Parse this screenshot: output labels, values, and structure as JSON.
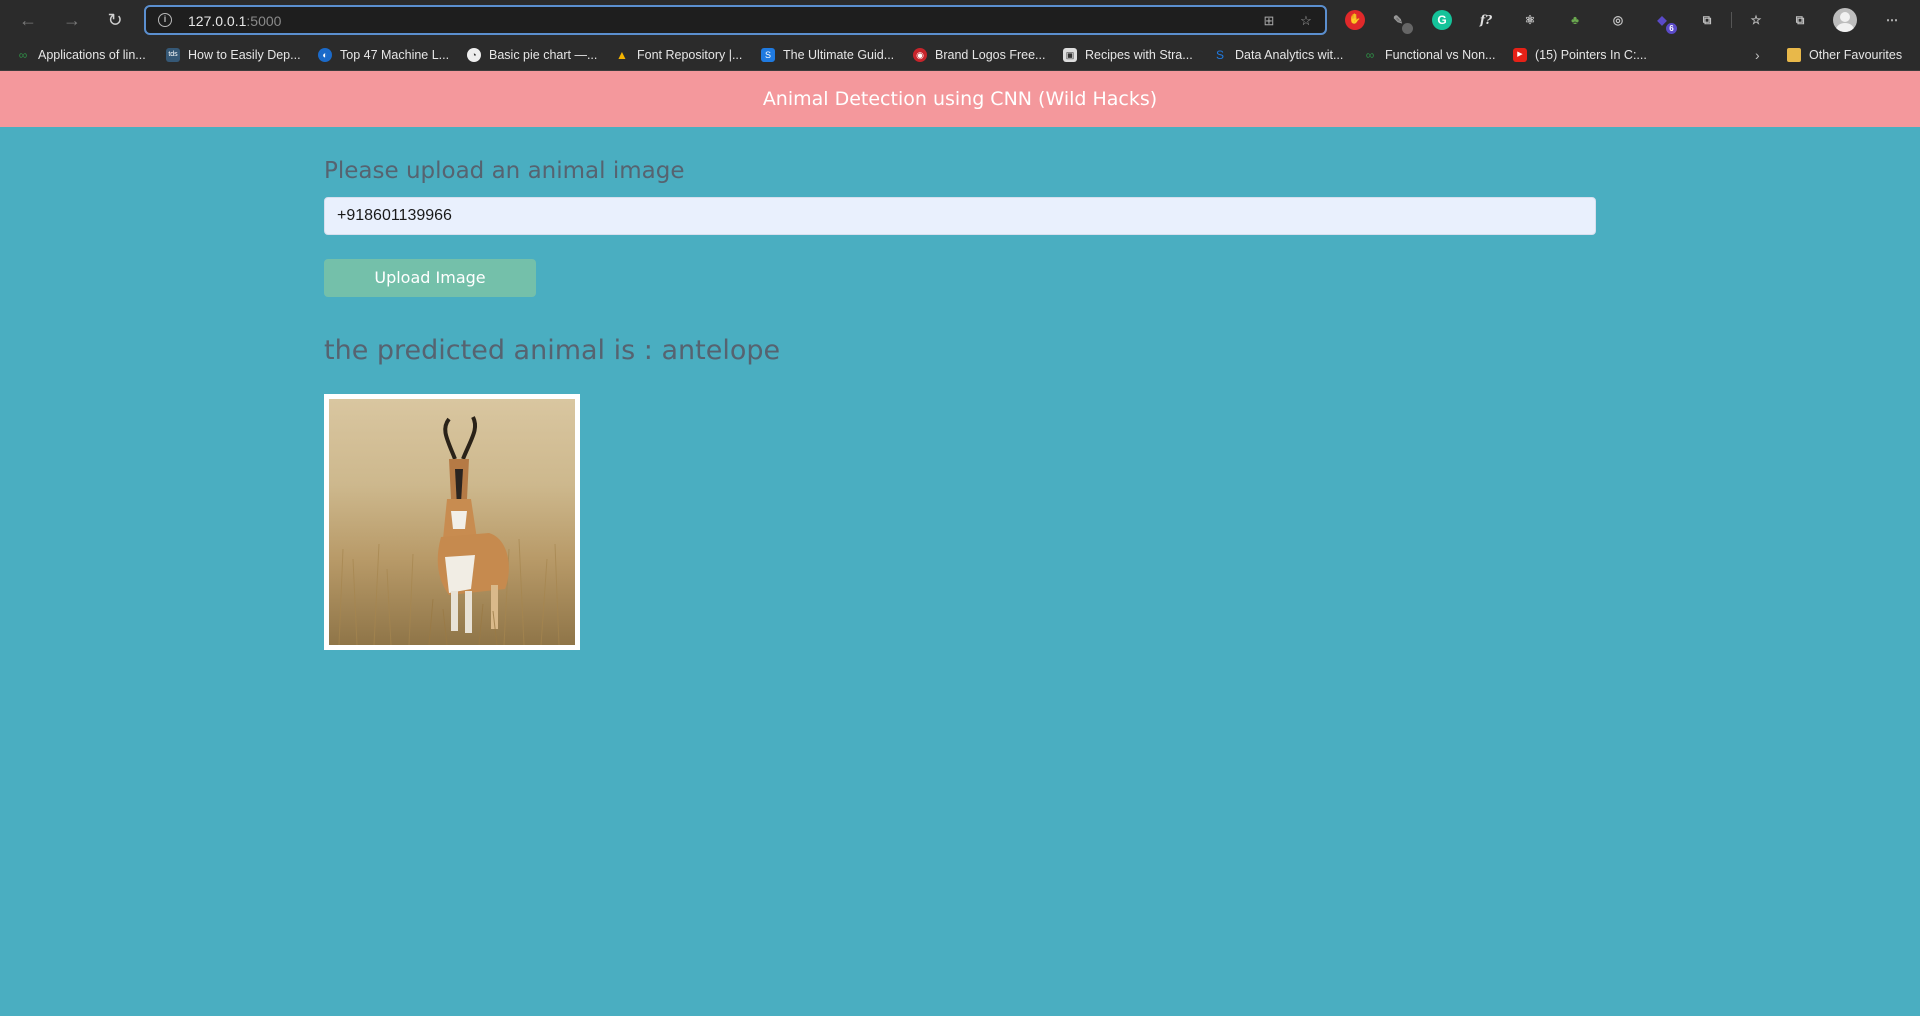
{
  "browser": {
    "url_host": "127.0.0.1",
    "url_port": ":5000",
    "extensions": [
      {
        "icon": "hand-stop-icon",
        "color": "#e0292a"
      },
      {
        "icon": "pen-tool-icon",
        "color": "#555"
      },
      {
        "icon": "grammarly-icon",
        "color": "#15c39a",
        "glyph": "G"
      },
      {
        "icon": "formula-icon",
        "color": "transparent",
        "glyph": "f?"
      },
      {
        "icon": "react-icon",
        "color": "transparent",
        "glyph": "⚛"
      },
      {
        "icon": "tree-icon",
        "color": "transparent",
        "glyph": "🌳"
      },
      {
        "icon": "target-icon",
        "color": "transparent",
        "glyph": "◎"
      },
      {
        "icon": "extension-badge-icon",
        "color": "transparent",
        "glyph": "",
        "badge": "6"
      }
    ]
  },
  "bookmarks": [
    {
      "label": "Applications of lin...",
      "icon": "geeks-icon",
      "color": "#2f8d46",
      "glyph": "∞"
    },
    {
      "label": "How to Easily Dep...",
      "icon": "tds-icon",
      "color": "#355876",
      "glyph": "tds"
    },
    {
      "label": "Top 47 Machine L...",
      "icon": "springboard-icon",
      "color": "#1b6ac9",
      "glyph": "◐"
    },
    {
      "label": "Basic pie chart —...",
      "icon": "matplotlib-icon",
      "color": "#eeeeee",
      "glyph": "◔"
    },
    {
      "label": "Font Repository |...",
      "icon": "drive-icon",
      "color": "transparent",
      "glyph": "▲"
    },
    {
      "label": "The Ultimate Guid...",
      "icon": "s-blue-icon",
      "color": "#1f7ae0",
      "glyph": "S"
    },
    {
      "label": "Brand Logos Free...",
      "icon": "brand-logos-icon",
      "color": "#c7242b",
      "glyph": "◉"
    },
    {
      "label": "Recipes with Stra...",
      "icon": "recipes-icon",
      "color": "#dddddd",
      "glyph": "▣"
    },
    {
      "label": "Data Analytics wit...",
      "icon": "data-analytics-icon",
      "color": "transparent",
      "glyph": "S"
    },
    {
      "label": "Functional vs Non...",
      "icon": "geeks-icon",
      "color": "#2f8d46",
      "glyph": "∞"
    },
    {
      "label": "(15) Pointers In C:...",
      "icon": "youtube-icon",
      "color": "#e62117",
      "glyph": "▶"
    }
  ],
  "other_favourites": "Other Favourites",
  "app": {
    "title": "Animal Detection using CNN (Wild Hacks)",
    "upload_label": "Please upload an animal image",
    "file_input_value": "+918601139966",
    "upload_button": "Upload Image",
    "prediction_text": "the predicted animal is : antelope"
  }
}
